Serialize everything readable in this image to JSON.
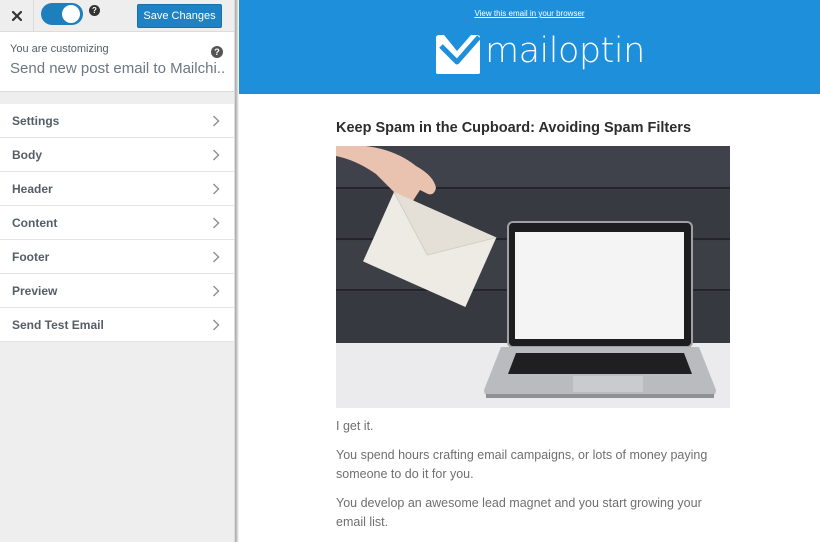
{
  "sidebar": {
    "close_label": "Close",
    "toggle_on": true,
    "help_icon": "?",
    "save_label": "Save Changes",
    "customizing_label": "You are customizing",
    "customizing_title": "Send new post email to Mailchi...",
    "items": [
      {
        "label": "Settings"
      },
      {
        "label": "Body"
      },
      {
        "label": "Header"
      },
      {
        "label": "Content"
      },
      {
        "label": "Footer"
      },
      {
        "label": "Preview"
      },
      {
        "label": "Send Test Email"
      }
    ]
  },
  "email": {
    "view_in_browser": "View this email in your browser",
    "logo_text": "mailoptin",
    "header_color": "#1e8fdb",
    "title": "Keep Spam in the Cupboard: Avoiding Spam Filters",
    "hero_alt": "Hand holding envelope next to laptop",
    "paragraphs": [
      "I get it.",
      "You spend hours crafting email campaigns, or lots of money paying someone to do it for you.",
      "You develop an awesome lead magnet and you start growing your email list."
    ]
  },
  "colors": {
    "accent": "#1e82c4",
    "toggle": "#1e7fbd"
  }
}
